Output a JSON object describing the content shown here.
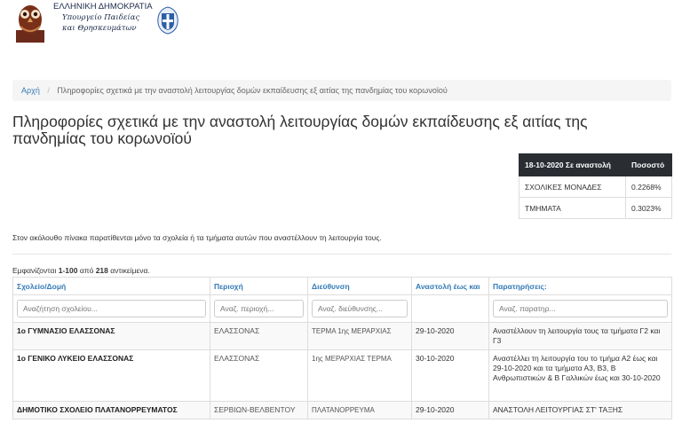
{
  "header": {
    "line1": "ΕΛΛΗΝΙΚΗ ΔΗΜΟΚΡΑΤΙΑ",
    "line2": "Υπουργείο Παιδείας",
    "line3": "και Θρησκευμάτων"
  },
  "breadcrumb": {
    "home": "Αρχή",
    "current": "Πληροφορίες σχετικά με την αναστολή λειτουργίας δομών εκπαίδευσης εξ αιτίας της πανδημίας του κορωνοϊού"
  },
  "title": "Πληροφορίες σχετικά με την αναστολή λειτουργίας δομών εκπαίδευσης εξ αιτίας της πανδημίας του κορωνοϊού",
  "stats": {
    "header_date": "18-10-2020 Σε αναστολή",
    "header_pct": "Ποσοστό",
    "rows": [
      {
        "label": "ΣΧΟΛΙΚΕΣ ΜΟΝΑΔΕΣ",
        "value": "0.2268%"
      },
      {
        "label": "ΤΜΗΜΑΤΑ",
        "value": "0.3023%"
      }
    ]
  },
  "intro": "Στον ακόλουθο πίνακα παρατίθενται μόνο τα σχολεία ή τα τμήματα αυτών που αναστέλλουν τη λειτουργία τους.",
  "summary": {
    "prefix": "Εμφανίζονται ",
    "range": "1-100",
    "middle": " από ",
    "total": "218",
    "suffix": " αντικείμενα."
  },
  "table": {
    "columns": [
      "Σχολείο/Δομή",
      "Περιοχή",
      "Διεύθυνση",
      "Αναστολή έως και",
      "Παρατηρήσεις:"
    ],
    "filters": {
      "school": "Αναζήτηση σχολείου...",
      "region": "Αναζ. περιοχή...",
      "address": "Αναζ. διεύθυνσης...",
      "notes": "Αναζ. παρατηρ..."
    },
    "rows": [
      {
        "school": "1ο ΓΥΜΝΑΣΙΟ ΕΛΑΣΣΟΝΑΣ",
        "region": "ΕΛΑΣΣΟΝΑΣ",
        "address": "ΤΕΡΜΑ 1ης ΜΕΡΑΡΧΙΑΣ",
        "until": "29-10-2020",
        "notes": "Αναστέλλουν τη λειτουργία τους τα τμήματα Γ2 και Γ3"
      },
      {
        "school": "1ο ΓΕΝΙΚΟ ΛΥΚΕΙΟ ΕΛΑΣΣΟΝΑΣ",
        "region": "ΕΛΑΣΣΟΝΑΣ",
        "address": "1ης ΜΕΡΑΡΧΙΑΣ ΤΕΡΜΑ",
        "until": "30-10-2020",
        "notes": "Αναστέλλει τη λειτουργία του το τμήμα Α2 έως και 29-10-2020 και τα τμήματα Α3, Β3, Β Ανθρωπιστικών & Β Γαλλικών έως και 30-10-2020"
      },
      {
        "school": "ΔΗΜΟΤΙΚΟ ΣΧΟΛΕΙΟ ΠΛΑΤΑΝΟΡΡΕΥΜΑΤΟΣ",
        "region": "ΣΕΡΒΙΩΝ-ΒΕΛΒΕΝΤΟΥ",
        "address": "ΠΛΑΤΑΝΟΡΡΕΥΜΑ",
        "until": "29-10-2020",
        "notes": "ΑΝΑΣΤΟΛΗ ΛΕΙΤΟΥΡΓΙΑΣ ΣΤ' ΤΑΞΗΣ"
      }
    ]
  }
}
